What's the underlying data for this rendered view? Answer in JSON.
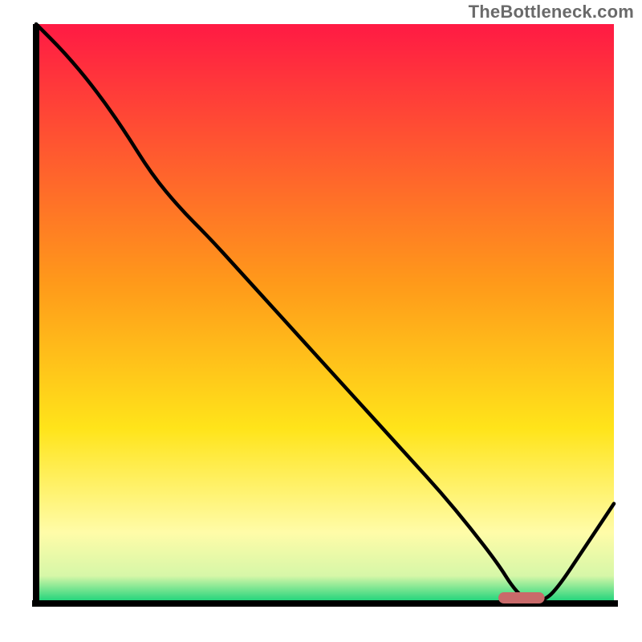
{
  "watermark": "TheBottleneck.com",
  "chart_data": {
    "type": "line",
    "x": [
      0.0,
      0.05,
      0.1,
      0.15,
      0.2,
      0.25,
      0.3,
      0.35,
      0.4,
      0.45,
      0.5,
      0.55,
      0.6,
      0.65,
      0.7,
      0.75,
      0.8,
      0.825,
      0.85,
      0.875,
      0.9,
      0.95,
      1.0
    ],
    "values": [
      1.0,
      0.95,
      0.89,
      0.82,
      0.74,
      0.68,
      0.63,
      0.575,
      0.52,
      0.465,
      0.41,
      0.355,
      0.3,
      0.245,
      0.19,
      0.13,
      0.065,
      0.025,
      0.0,
      0.0,
      0.02,
      0.095,
      0.17
    ],
    "marker": {
      "x_start": 0.8,
      "x_end": 0.88,
      "y": 0.0
    },
    "title": "",
    "xlabel": "",
    "ylabel": "",
    "xlim": [
      0,
      1
    ],
    "ylim": [
      0,
      1
    ],
    "grid": false,
    "background_gradient": [
      {
        "stop": 0.0,
        "color": "#ff1a44"
      },
      {
        "stop": 0.45,
        "color": "#ff9a1a"
      },
      {
        "stop": 0.7,
        "color": "#ffe41a"
      },
      {
        "stop": 0.88,
        "color": "#fffca8"
      },
      {
        "stop": 0.955,
        "color": "#d6f7a8"
      },
      {
        "stop": 1.0,
        "color": "#1bd37a"
      }
    ],
    "colors": {
      "line": "#000000",
      "axis": "#000000",
      "marker": "#c96a6a"
    }
  }
}
